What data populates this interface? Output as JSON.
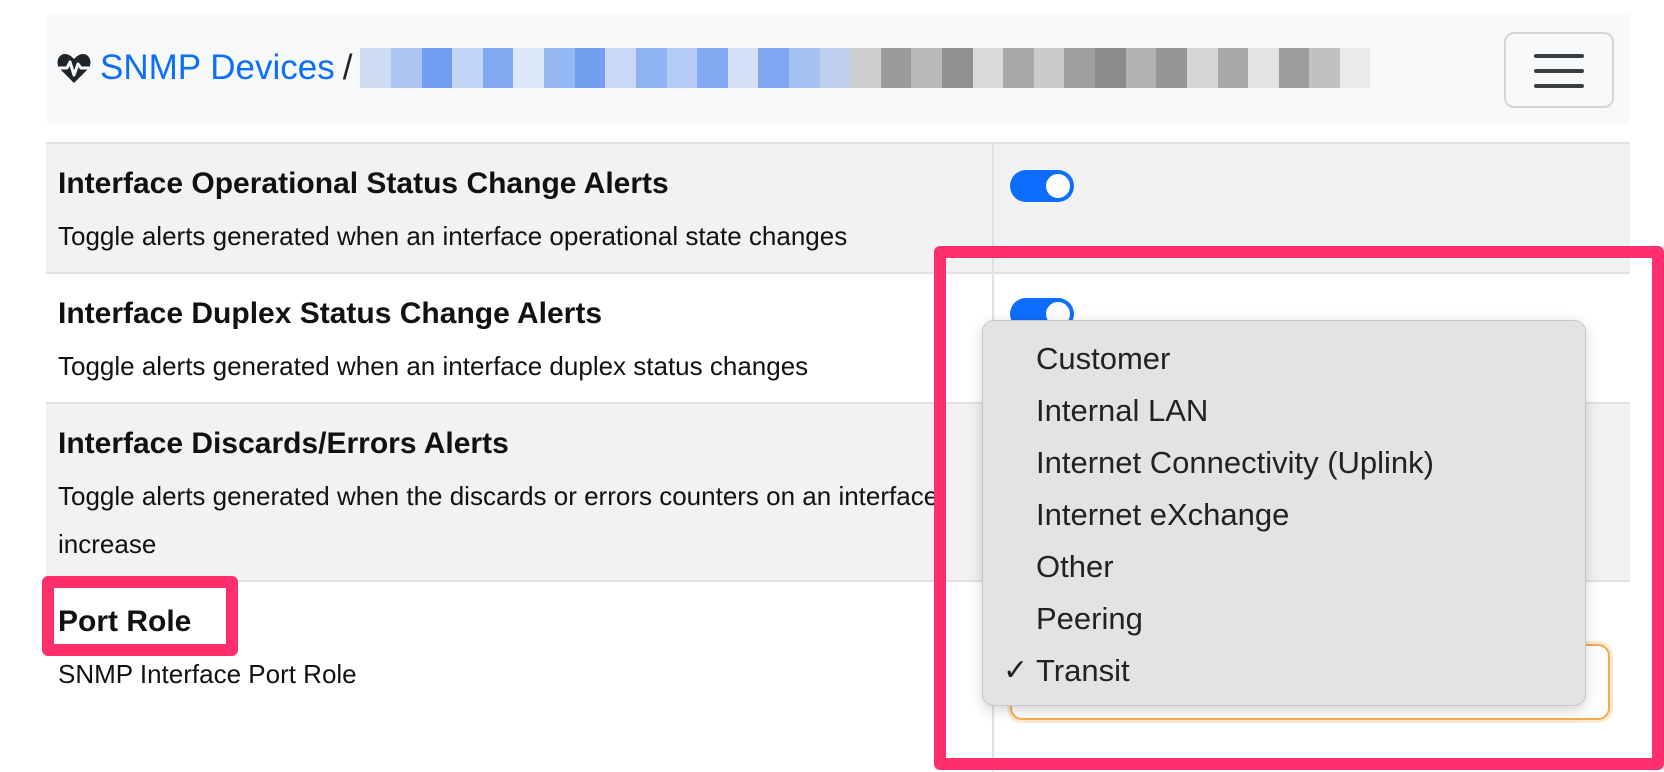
{
  "header": {
    "icon": "heartbeat-icon",
    "breadcrumb_link": "SNMP Devices",
    "separator": "/",
    "menu_icon": "hamburger-menu-icon"
  },
  "settings": [
    {
      "title": "Interface Operational Status Change Alerts",
      "description": "Toggle alerts generated when an interface operational state changes",
      "toggle_on": true
    },
    {
      "title": "Interface Duplex Status Change Alerts",
      "description": "Toggle alerts generated when an interface duplex status changes",
      "toggle_on": true
    },
    {
      "title": "Interface Discards/Errors Alerts",
      "description": "Toggle alerts generated when the discards or errors counters on an interface increase",
      "toggle_on": true
    },
    {
      "title": "Port Role",
      "description": "SNMP Interface Port Role"
    }
  ],
  "port_role_select": {
    "selected": "Transit",
    "check_mark": "✓",
    "options": [
      "Customer",
      "Internal LAN",
      "Internet Connectivity (Uplink)",
      "Internet eXchange",
      "Other",
      "Peering",
      "Transit"
    ]
  },
  "colors": {
    "link": "#0d6efd",
    "toggle": "#0d6efd",
    "highlight": "#ff2f6d",
    "select_focus": "#f0ad4e"
  }
}
